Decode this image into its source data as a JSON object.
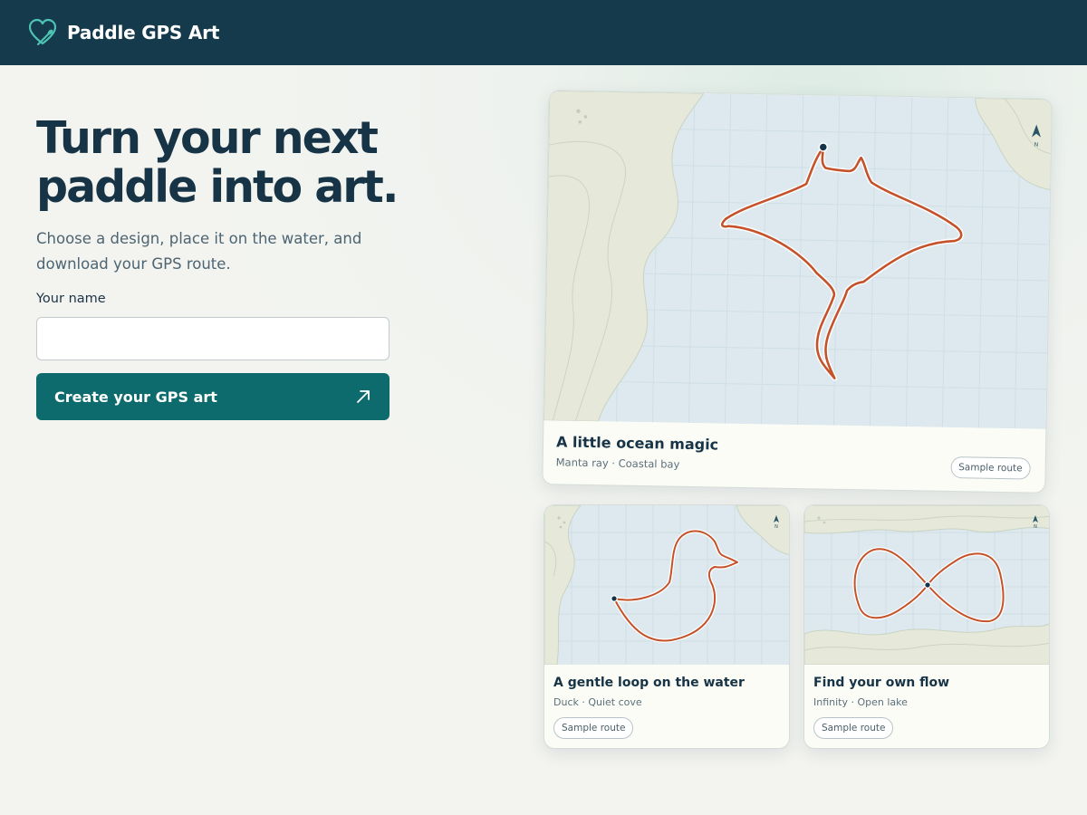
{
  "header": {
    "brand_name": "Paddle GPS Art",
    "brand_icon": "heart-paddle-icon"
  },
  "hero": {
    "title_line1": "Turn your next",
    "title_line2": "paddle into art.",
    "subtitle": "Choose a design, place it on the water, and download your GPS route."
  },
  "form": {
    "name_label": "Your name",
    "name_value": "",
    "name_placeholder": "",
    "submit_label": "Create your GPS art",
    "submit_icon": "arrow-up-right-icon"
  },
  "cards": [
    {
      "title": "A little ocean magic",
      "meta": "Manta ray · Coastal bay",
      "badge": "Sample route",
      "design": "manta-ray"
    },
    {
      "title": "A gentle loop on the water",
      "meta": "Duck · Quiet cove",
      "badge": "Sample route",
      "design": "duck"
    },
    {
      "title": "Find your own flow",
      "meta": "Infinity · Open lake",
      "badge": "Sample route",
      "design": "infinity"
    }
  ],
  "colors": {
    "header_bg": "#143a4c",
    "accent": "#0e6b6d",
    "route": "#c4522a",
    "water": "#dde9ee",
    "land": "#e6e9d9",
    "brand_icon": "#4fc3b4"
  }
}
